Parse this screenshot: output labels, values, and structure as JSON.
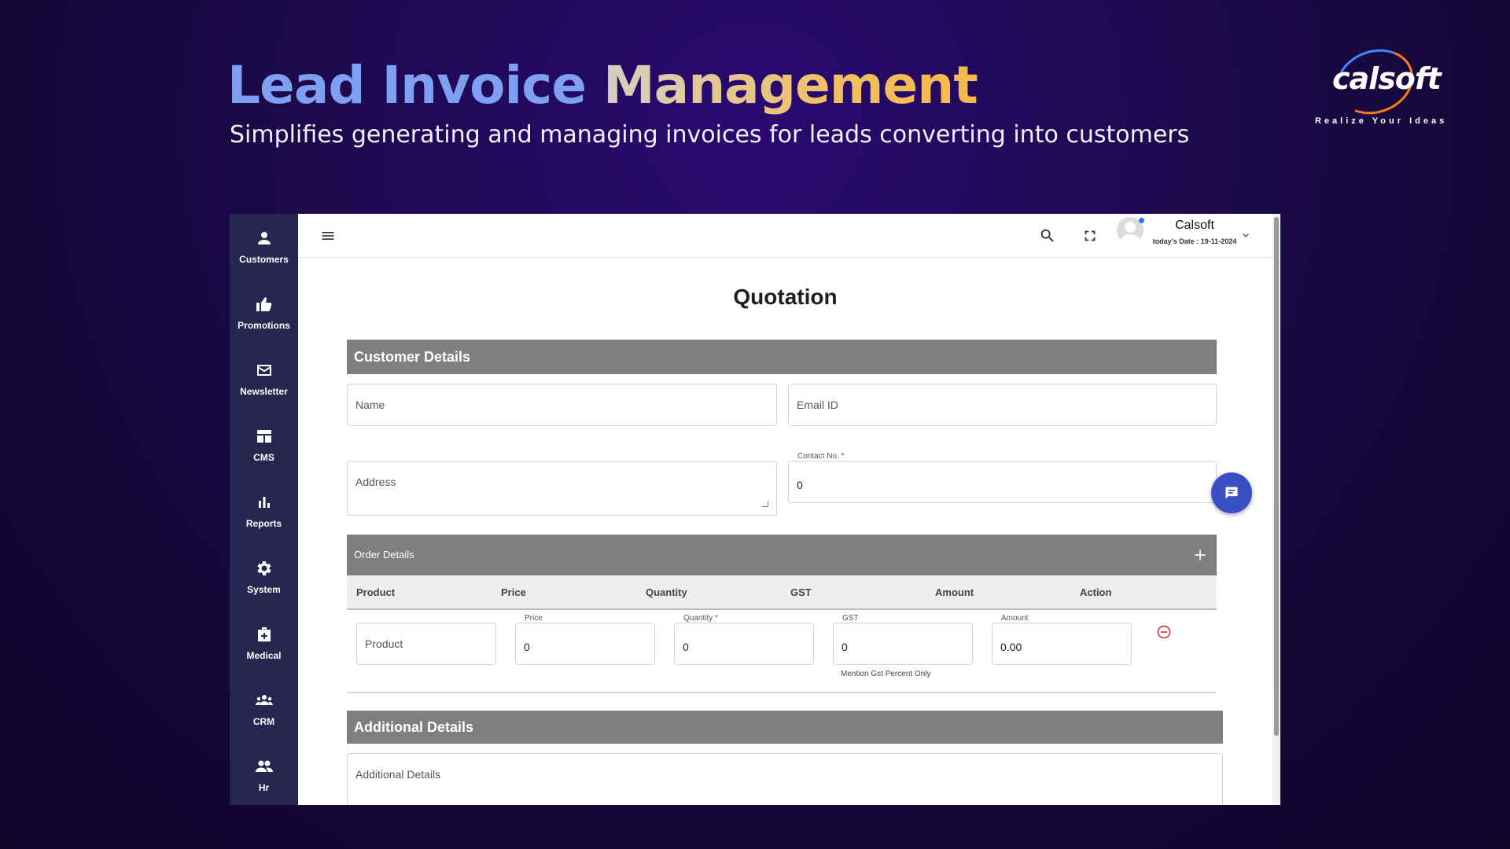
{
  "hero": {
    "title_part1": "Lead Invoice",
    "title_part2": "Management",
    "subtitle": "Simplifies generating and managing invoices for leads converting into customers"
  },
  "brand": {
    "name": "calsoft",
    "tagline": "Realize Your Ideas"
  },
  "sidebar": {
    "items": [
      {
        "label": "Customers",
        "icon": "person-icon"
      },
      {
        "label": "Promotions",
        "icon": "thumbs-up-icon"
      },
      {
        "label": "Newsletter",
        "icon": "mail-icon"
      },
      {
        "label": "CMS",
        "icon": "dashboard-icon"
      },
      {
        "label": "Reports",
        "icon": "bar-chart-icon"
      },
      {
        "label": "System",
        "icon": "gear-icon"
      },
      {
        "label": "Medical",
        "icon": "medical-bag-icon"
      },
      {
        "label": "CRM",
        "icon": "group-icon"
      },
      {
        "label": "Hr",
        "icon": "people-icon"
      }
    ]
  },
  "topbar": {
    "user_name": "Calsoft",
    "date_text": "today's Date : 19-11-2024"
  },
  "page": {
    "title": "Quotation"
  },
  "customer_details": {
    "heading": "Customer Details",
    "name_placeholder": "Name",
    "email_placeholder": "Email ID",
    "address_placeholder": "Address",
    "contact_label": "Contact No. *",
    "contact_value": "0"
  },
  "order_details": {
    "heading": "Order Details",
    "columns": [
      "Product",
      "Price",
      "Quantity",
      "GST",
      "Amount",
      "Action"
    ],
    "row": {
      "product_placeholder": "Product",
      "price_label": "Price",
      "price_value": "0",
      "quantity_label": "Quantity *",
      "quantity_value": "0",
      "gst_label": "GST",
      "gst_value": "0",
      "gst_hint": "Mention Gst Percent Only",
      "amount_label": "Amount",
      "amount_value": "0.00"
    }
  },
  "additional_details": {
    "heading": "Additional Details",
    "placeholder": "Additional Details"
  },
  "colors": {
    "sidebar_bg": "#262650",
    "section_bar": "#7f7f7f",
    "fab": "#3a4fc4",
    "remove": "#e03b3b"
  }
}
